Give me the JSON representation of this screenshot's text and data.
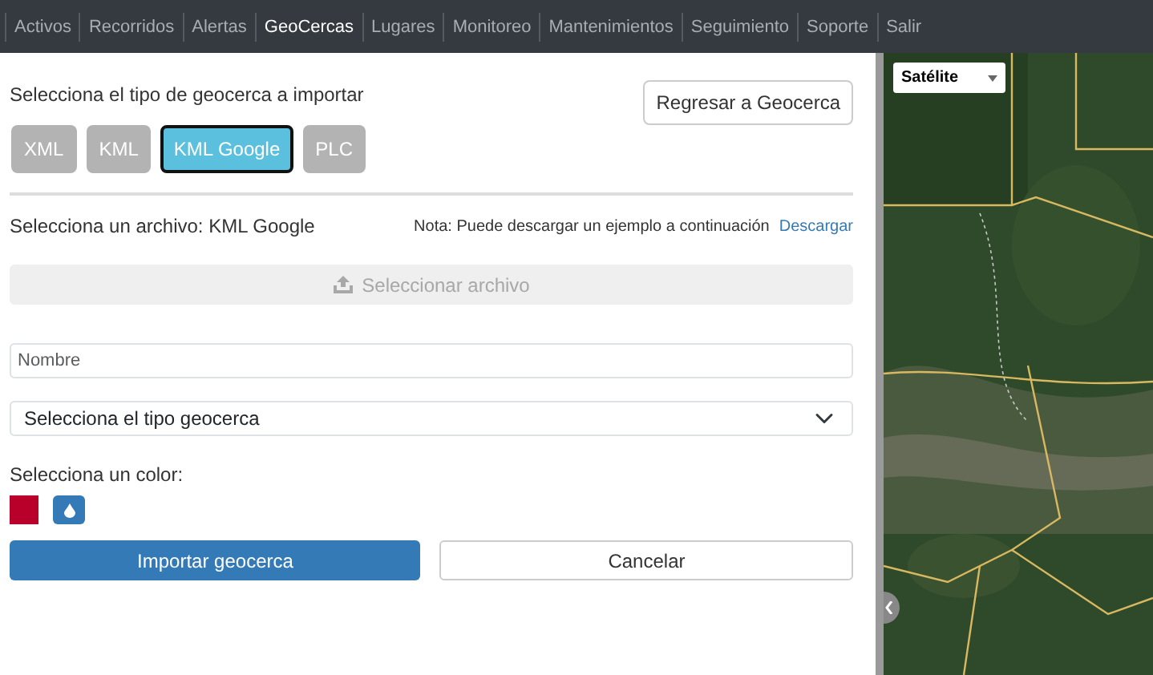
{
  "nav": [
    {
      "label": "Activos",
      "selected": false
    },
    {
      "label": "Recorridos",
      "selected": false
    },
    {
      "label": "Alertas",
      "selected": false
    },
    {
      "label": "GeoCercas",
      "selected": true
    },
    {
      "label": "Lugares",
      "selected": false
    },
    {
      "label": "Monitoreo",
      "selected": false
    },
    {
      "label": "Mantenimientos",
      "selected": false
    },
    {
      "label": "Seguimiento",
      "selected": false
    },
    {
      "label": "Soporte",
      "selected": false
    },
    {
      "label": "Salir",
      "selected": false
    }
  ],
  "type_prompt": "Selecciona el tipo de geocerca a importar",
  "back_button": "Regresar a Geocerca",
  "types": [
    {
      "label": "XML",
      "selected": false
    },
    {
      "label": "KML",
      "selected": false
    },
    {
      "label": "KML Google",
      "selected": true
    },
    {
      "label": "PLC",
      "selected": false
    }
  ],
  "file_prompt": "Selecciona un archivo: KML Google",
  "note": "Nota: Puede descargar un ejemplo a continuación",
  "download_link": "Descargar",
  "file_button": {
    "label": "Seleccionar archivo",
    "disabled": true
  },
  "name_field": {
    "placeholder": "Nombre"
  },
  "type_select": {
    "value": "Selecciona el tipo geocerca"
  },
  "color_label": "Selecciona un color:",
  "color": {
    "color": "#b8002a"
  },
  "import_button": "Importar geocerca",
  "cancel_button": "Cancelar",
  "map": {
    "kind": "picture",
    "map_type": "Satélite"
  }
}
